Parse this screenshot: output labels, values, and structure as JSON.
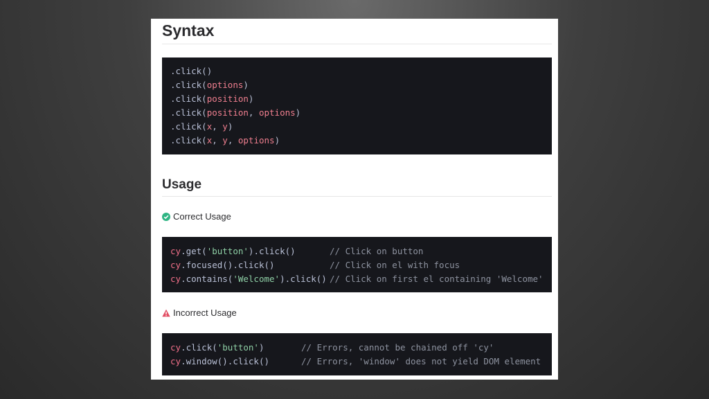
{
  "syntax": {
    "title": "Syntax",
    "lines": [
      {
        "method": ".click(",
        "params": [],
        "close": ")"
      },
      {
        "method": ".click(",
        "params": [
          "options"
        ],
        "close": ")"
      },
      {
        "method": ".click(",
        "params": [
          "position"
        ],
        "close": ")"
      },
      {
        "method": ".click(",
        "params": [
          "position",
          "options"
        ],
        "close": ")"
      },
      {
        "method": ".click(",
        "params": [
          "x",
          "y"
        ],
        "close": ")"
      },
      {
        "method": ".click(",
        "params": [
          "x",
          "y",
          "options"
        ],
        "close": ")"
      }
    ]
  },
  "usage": {
    "title": "Usage",
    "correct": {
      "label": "Correct Usage",
      "icon": "check-circle-icon",
      "icon_color": "#2fb584",
      "lines": [
        {
          "cy": "cy",
          "a": ".get(",
          "str": "'button'",
          "b": ").click()",
          "comment": "// Click on button"
        },
        {
          "cy": "cy",
          "a": ".focused().click()",
          "str": "",
          "b": "",
          "comment": "// Click on el with focus"
        },
        {
          "cy": "cy",
          "a": ".contains(",
          "str": "'Welcome'",
          "b": ").click()",
          "comment": "// Click on first el containing 'Welcome'"
        }
      ]
    },
    "incorrect": {
      "label": "Incorrect Usage",
      "icon": "warning-triangle-icon",
      "icon_color": "#e24f64",
      "lines": [
        {
          "cy": "cy",
          "a": ".click(",
          "str": "'button'",
          "b": ")",
          "comment": "// Errors, cannot be chained off 'cy'"
        },
        {
          "cy": "cy",
          "a": ".window().click()",
          "str": "",
          "b": "",
          "comment": "// Errors, 'window' does not yield DOM element"
        }
      ]
    }
  }
}
